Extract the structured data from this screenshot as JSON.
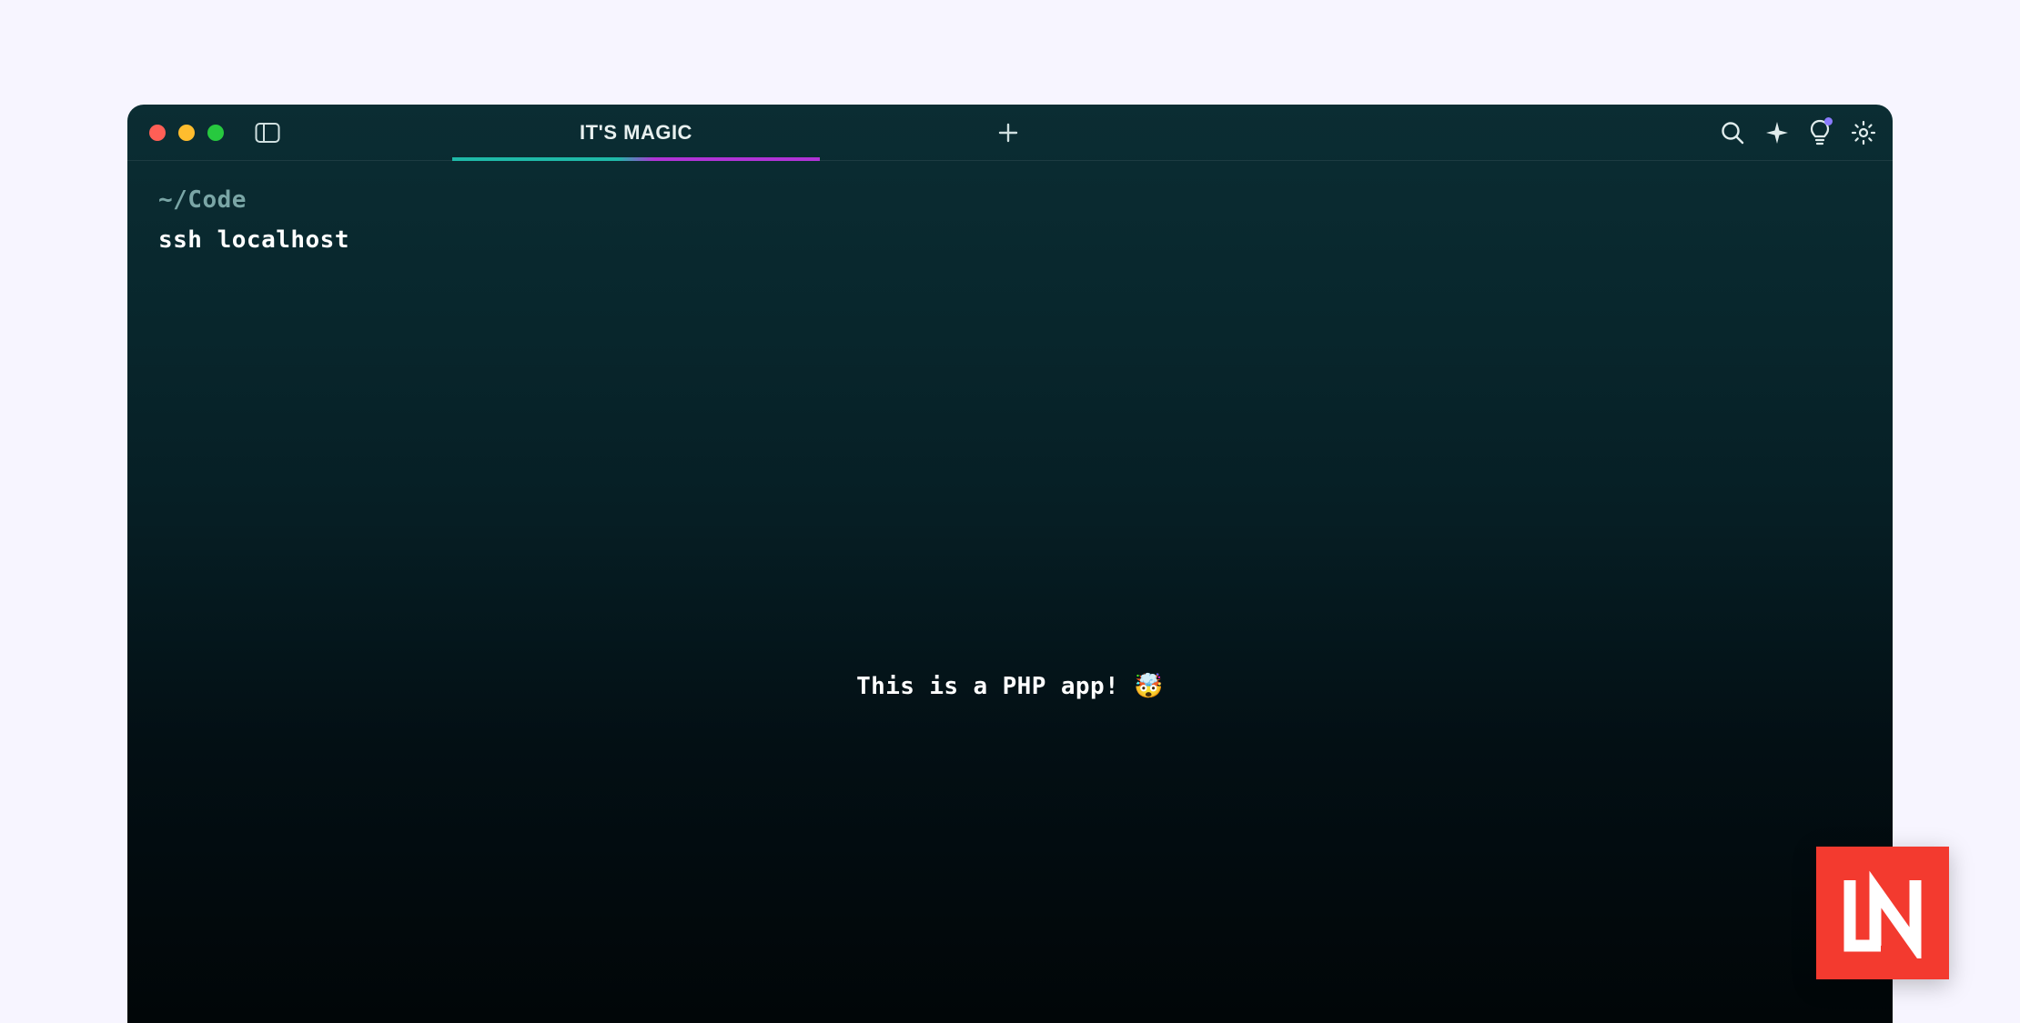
{
  "window": {
    "tab_title": "IT'S MAGIC"
  },
  "terminal": {
    "prompt_path": "~/Code",
    "command": "ssh localhost",
    "banner": "This is a PHP app! 🤯"
  },
  "badge": {
    "text": "LN"
  }
}
